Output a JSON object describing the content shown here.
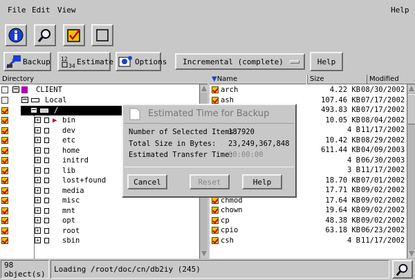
{
  "menu": {
    "file": "File",
    "edit": "Edit",
    "view": "View",
    "help": "Help"
  },
  "toolbar_icons": [
    "info-icon",
    "search-icon",
    "check-icon",
    "stop-icon"
  ],
  "actions": {
    "backup": "Backup",
    "estimate": "Estimate",
    "options": "Options",
    "backup_type": "Incremental (complete)",
    "help": "Help"
  },
  "tree": {
    "header": "Directory",
    "client": "CLIENT",
    "local": "Local",
    "root": "/",
    "dirs": [
      "bin",
      "dev",
      "etc",
      "home",
      "initrd",
      "lib",
      "lost+found",
      "media",
      "misc",
      "mnt",
      "opt",
      "root",
      "sbin"
    ]
  },
  "files": {
    "col_name": "Name",
    "col_size": "Size",
    "col_modified": "Modified",
    "rows": [
      {
        "name": "arch",
        "size": "4.22 KB",
        "modified": "08/30/2002"
      },
      {
        "name": "ash",
        "size": "107.46 KB",
        "modified": "07/17/2002"
      },
      {
        "name": "",
        "size": "493.83 KB",
        "modified": "07/17/2002"
      },
      {
        "name": "",
        "size": "10.05 KB",
        "modified": "08/04/2002"
      },
      {
        "name": "",
        "size": "4 B",
        "modified": "11/17/2002"
      },
      {
        "name": "",
        "size": "10.42 KB",
        "modified": "08/29/2002"
      },
      {
        "name": "",
        "size": "611.44 KB",
        "modified": "04/09/2003"
      },
      {
        "name": "",
        "size": "4 B",
        "modified": "06/30/2003"
      },
      {
        "name": "",
        "size": "3 B",
        "modified": "11/17/2002"
      },
      {
        "name": "",
        "size": "18.70 KB",
        "modified": "07/01/2002"
      },
      {
        "name": "",
        "size": "17.71 KB",
        "modified": "09/02/2002"
      },
      {
        "name": "chmod",
        "size": "17.64 KB",
        "modified": "09/02/2002"
      },
      {
        "name": "chown",
        "size": "19.64 KB",
        "modified": "09/02/2002"
      },
      {
        "name": "cp",
        "size": "48.38 KB",
        "modified": "09/02/2002"
      },
      {
        "name": "cpio",
        "size": "63.18 KB",
        "modified": "06/23/2002"
      },
      {
        "name": "csh",
        "size": "4 B",
        "modified": "11/17/2002"
      }
    ]
  },
  "dialog": {
    "title": "Estimated Time for Backup",
    "items_label": "Number of Selected Items:",
    "items_value": "187920",
    "size_label": "Total Size in Bytes:",
    "size_value": "23,249,367,848",
    "time_label": "Estimated Transfer Time:",
    "time_value": "00:00:00",
    "cancel": "Cancel",
    "reset": "Reset",
    "help": "Help"
  },
  "status": {
    "count": "98 object(s)",
    "message": "Loading /root/doc/cn/db2iy (245)"
  }
}
